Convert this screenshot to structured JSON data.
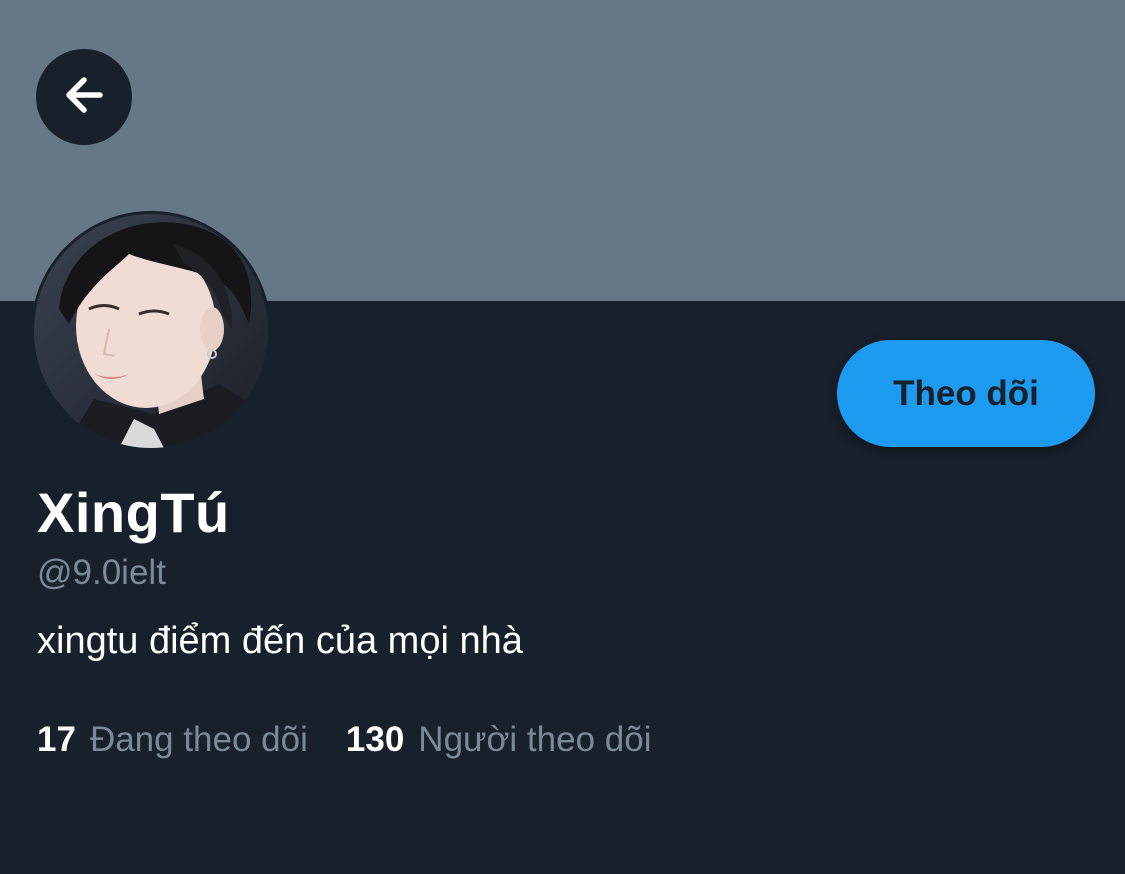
{
  "banner": {
    "color": "#667786"
  },
  "nav": {
    "back_icon": "arrow-left-icon"
  },
  "profile": {
    "name": "XingTú",
    "handle": "@9.0ielt",
    "bio": "xingtu điểm đến của mọi nhà",
    "avatar_alt": "profile photo"
  },
  "actions": {
    "follow_label": "Theo dõi"
  },
  "stats": {
    "following_count": "17",
    "following_label": "Đang theo dõi",
    "followers_count": "130",
    "followers_label": "Người theo dõi"
  },
  "colors": {
    "background": "#17202b",
    "accent": "#1d9bf0",
    "muted_text": "#7a8a99"
  }
}
